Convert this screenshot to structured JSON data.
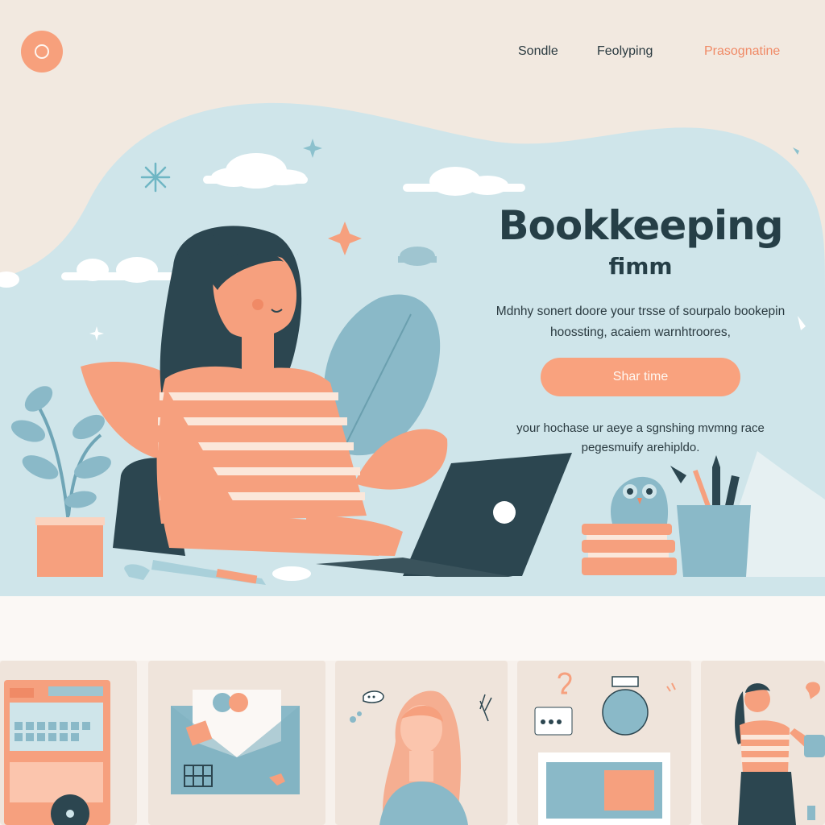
{
  "header": {
    "logo_icon": "circle-logo-icon",
    "nav": [
      {
        "label": "Sondle"
      },
      {
        "label": "Feolyping"
      },
      {
        "label": "Prasognatine"
      }
    ]
  },
  "hero": {
    "title": "Bookkeeping",
    "subtitle": "fimm",
    "description": "Mdnhy sonert doore your trsse of sourpalo bookepin hoossting, acaiem warnhtroores,",
    "cta_label": "Shar time",
    "note": "your hochase ur aeye a sgnshing mvmng race pegesmuify arehipldo."
  },
  "colors": {
    "accent": "#f9a27e",
    "dark": "#263f47",
    "sky": "#cfe5ea",
    "background": "#f2e9e0"
  },
  "cards": [
    {
      "icon": "calendar-illustration-icon"
    },
    {
      "icon": "envelope-illustration-icon"
    },
    {
      "icon": "woman-portrait-illustration-icon"
    },
    {
      "icon": "dashboard-illustration-icon"
    },
    {
      "icon": "woman-working-illustration-icon"
    }
  ]
}
